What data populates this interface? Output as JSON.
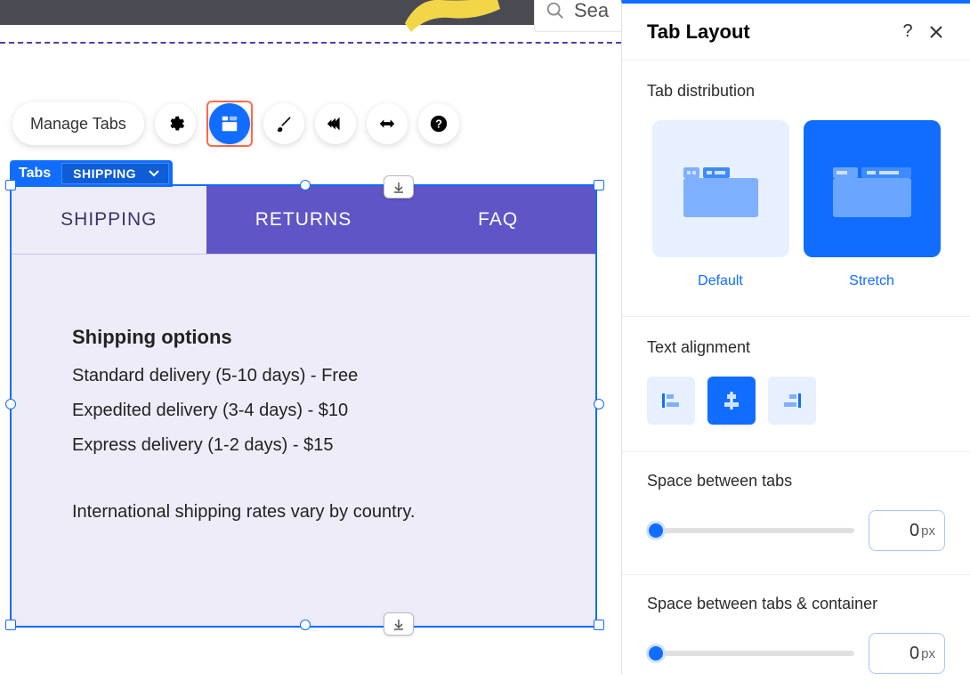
{
  "search": {
    "placeholder": "Sea"
  },
  "toolbar": {
    "manage_label": "Manage Tabs"
  },
  "tabs_badge": {
    "label": "Tabs",
    "selected": "SHIPPING"
  },
  "tabs": [
    {
      "label": "SHIPPING",
      "active": true
    },
    {
      "label": "RETURNS",
      "active": false
    },
    {
      "label": "FAQ",
      "active": false
    }
  ],
  "content": {
    "heading": "Shipping options",
    "line1": "Standard delivery (5-10 days) - Free",
    "line2": "Expedited delivery (3-4 days) - $10",
    "line3": "Express delivery (1-2 days) - $15",
    "line4": "International shipping rates vary by country."
  },
  "panel": {
    "title": "Tab Layout",
    "distribution": {
      "label": "Tab distribution",
      "options": [
        {
          "label": "Default",
          "selected": false
        },
        {
          "label": "Stretch",
          "selected": true
        }
      ]
    },
    "alignment": {
      "label": "Text alignment",
      "selected": "center"
    },
    "space_tabs": {
      "label": "Space between tabs",
      "value": "0",
      "unit": "px"
    },
    "space_container": {
      "label": "Space between tabs & container",
      "value": "0",
      "unit": "px"
    }
  }
}
